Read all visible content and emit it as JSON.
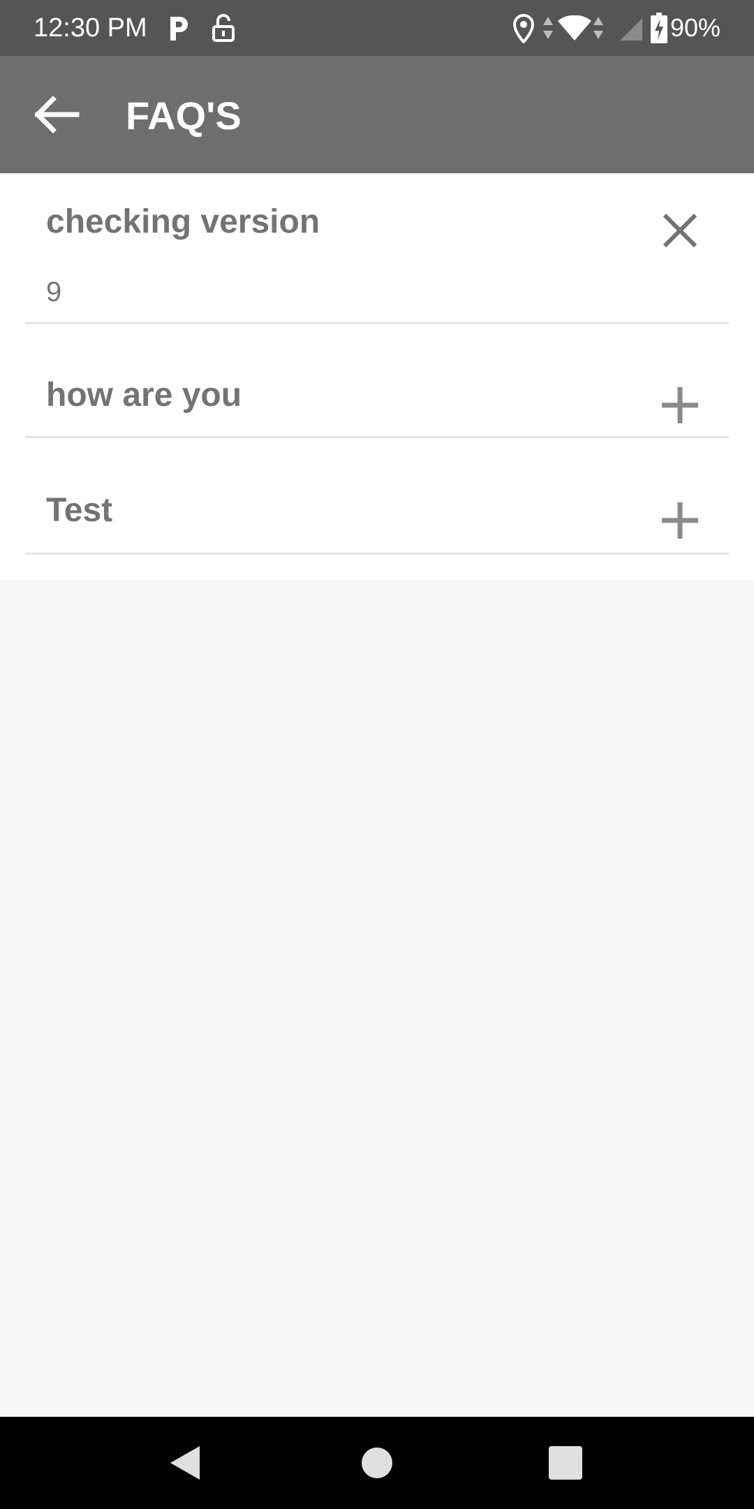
{
  "status_bar": {
    "time": "12:30 PM",
    "battery": "90%",
    "icons": [
      "parking-app-icon",
      "unlock-icon",
      "location-icon",
      "data-arrows-icon",
      "wifi-icon",
      "signal-icon",
      "battery-charging-icon"
    ]
  },
  "app_bar": {
    "title": "FAQ'S",
    "back_icon": "arrow-back-icon"
  },
  "faqs": [
    {
      "question": "checking version",
      "answer": "9",
      "expanded": true,
      "toggle_icon": "close-icon"
    },
    {
      "question": "how are you",
      "expanded": false,
      "toggle_icon": "plus-icon"
    },
    {
      "question": "Test",
      "expanded": false,
      "toggle_icon": "plus-icon"
    }
  ],
  "nav_bar": {
    "icons": [
      "nav-back-icon",
      "nav-home-icon",
      "nav-recents-icon"
    ]
  },
  "colors": {
    "status_bar": "#555555",
    "app_bar": "#6e6e6e",
    "text_gray": "#737373",
    "background": "#f9f9f9"
  }
}
